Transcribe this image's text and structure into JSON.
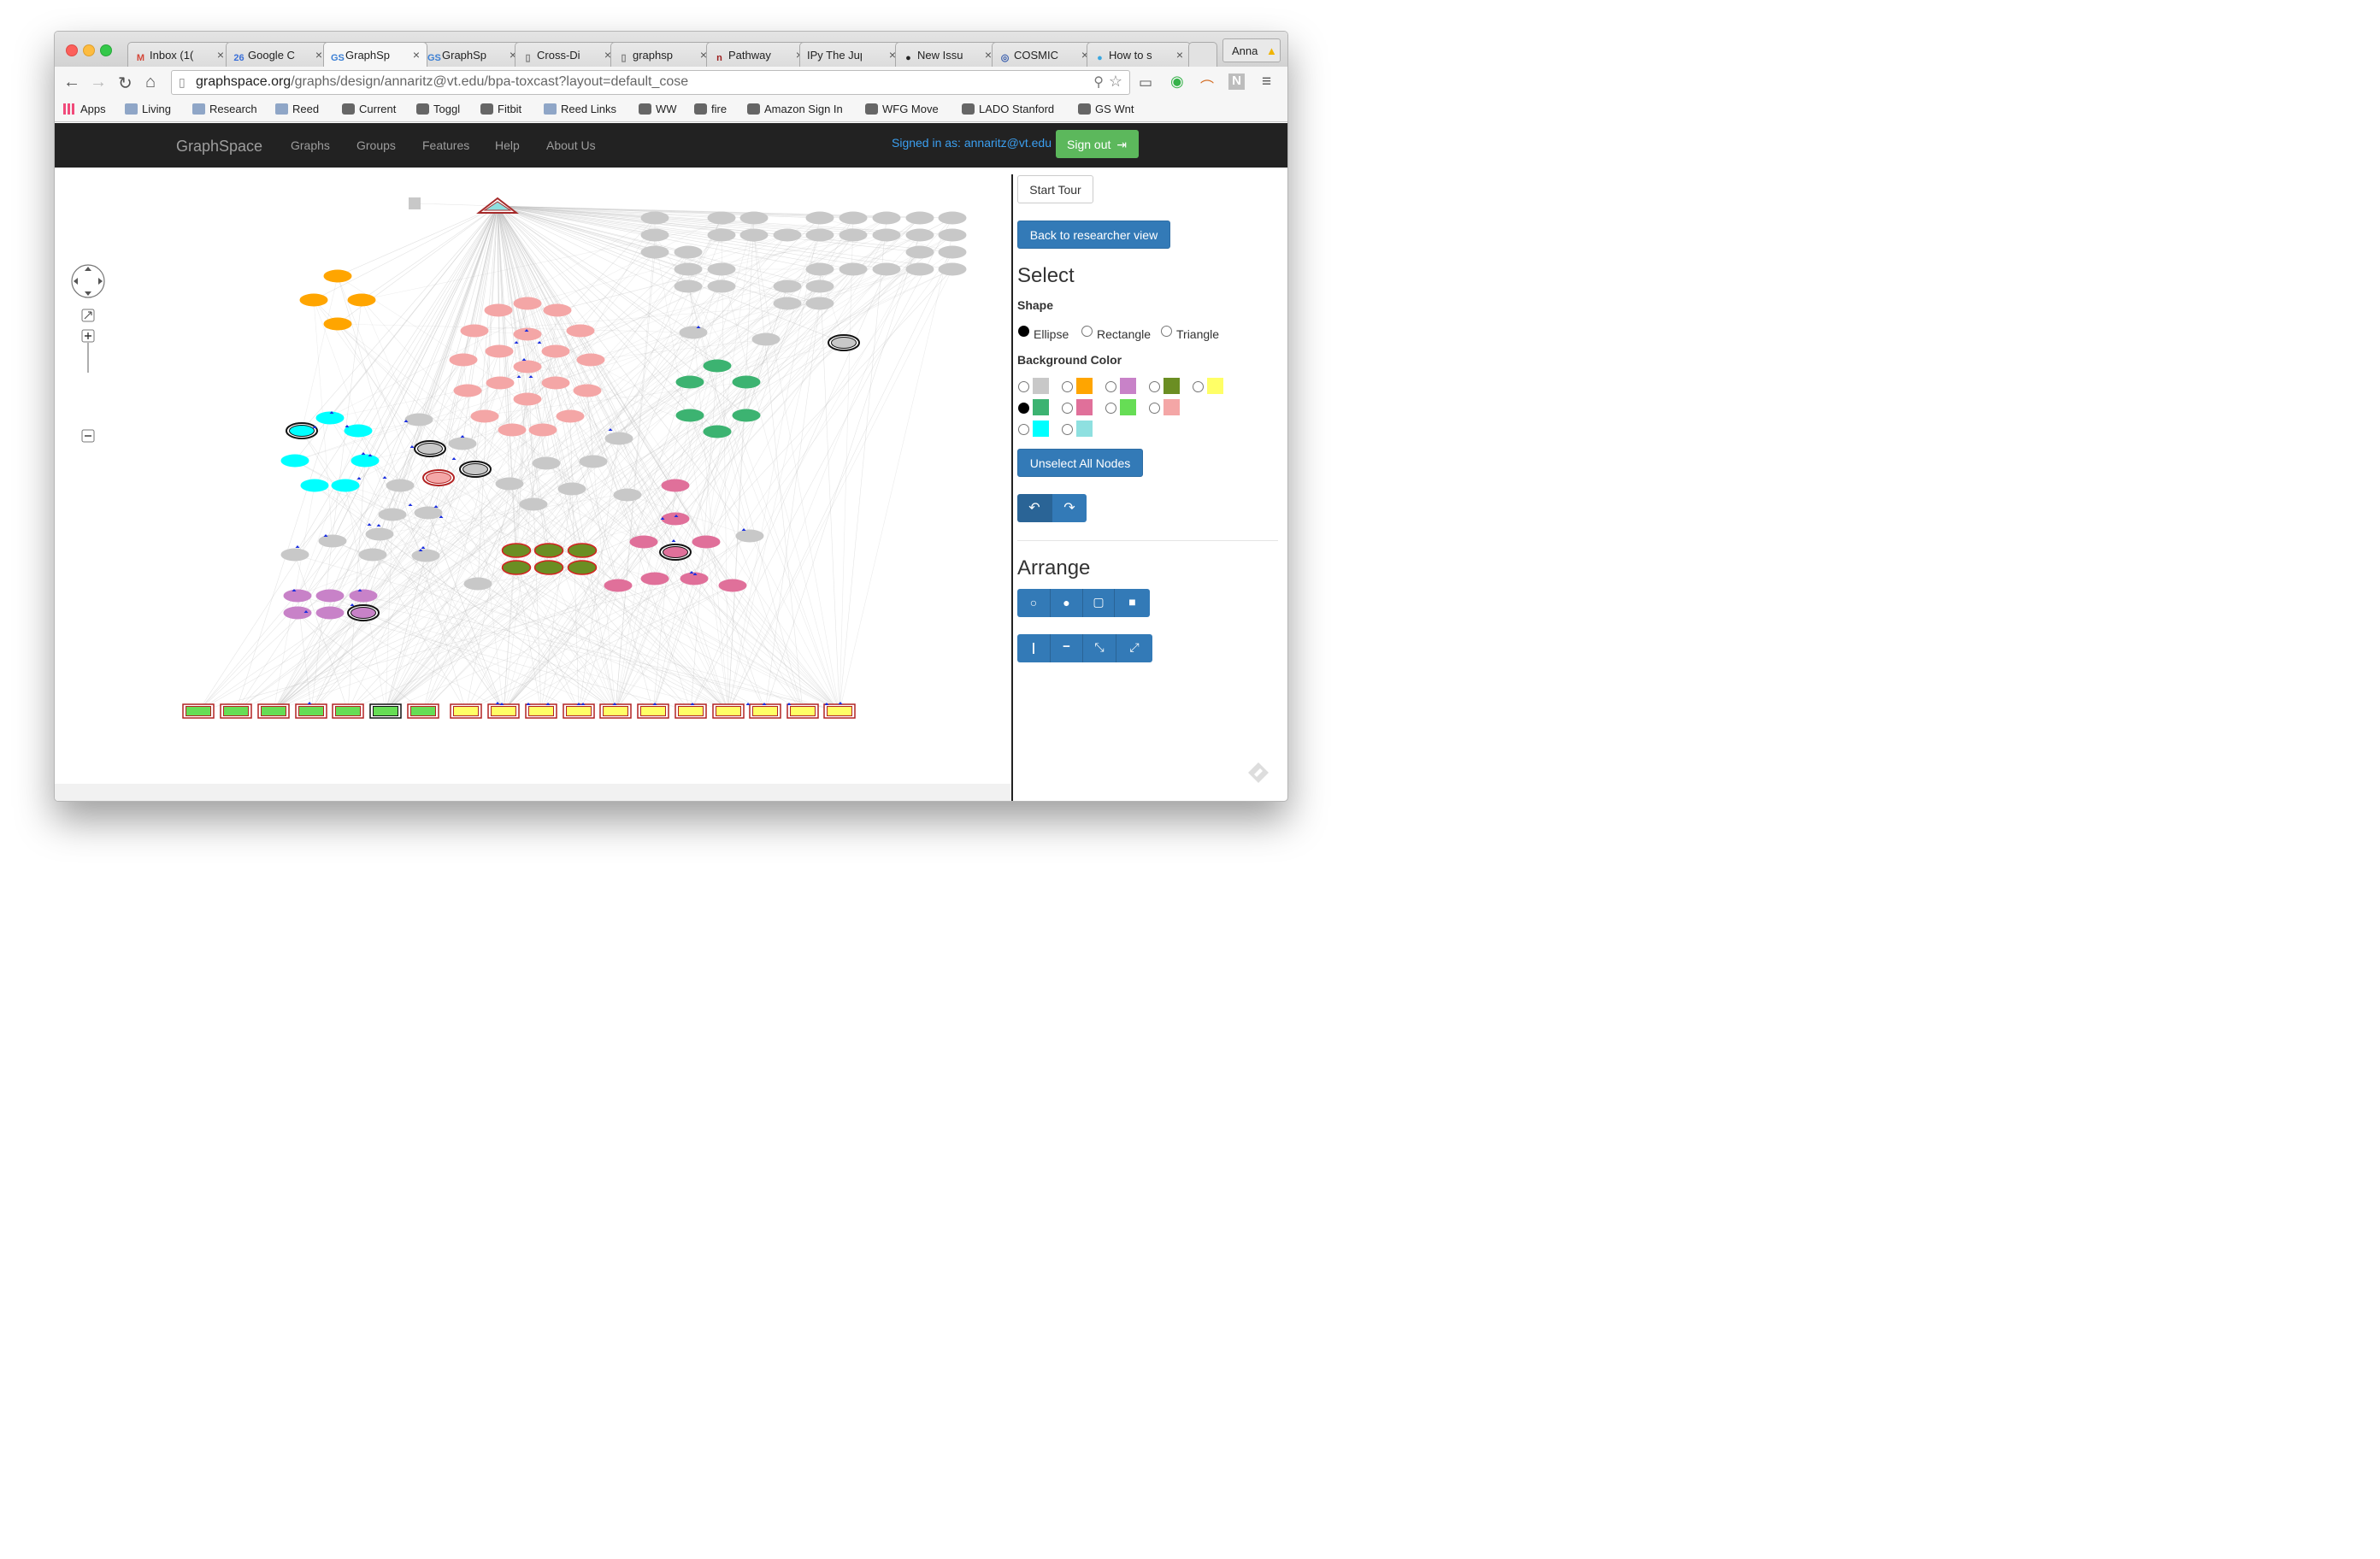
{
  "browser": {
    "tabs": [
      {
        "title": "Inbox (1(",
        "icon": "gmail-icon",
        "icon_glyph": "M",
        "icon_color": "#d44638"
      },
      {
        "title": "Google C",
        "icon": "calendar-icon",
        "icon_glyph": "26",
        "icon_color": "#3a6fd8"
      },
      {
        "title": "GraphSp",
        "icon": "graphspace-icon",
        "icon_glyph": "GS",
        "icon_color": "#3b7fd4",
        "active": true
      },
      {
        "title": "GraphSp",
        "icon": "graphspace-icon",
        "icon_glyph": "GS",
        "icon_color": "#3b7fd4"
      },
      {
        "title": "Cross-Di",
        "icon": "page-icon",
        "icon_glyph": "▯",
        "icon_color": "#777"
      },
      {
        "title": "graphsp",
        "icon": "page-icon",
        "icon_glyph": "▯",
        "icon_color": "#777"
      },
      {
        "title": "Pathway",
        "icon": "pathway-icon",
        "icon_glyph": "n",
        "icon_color": "#9b1b1b"
      },
      {
        "title": "IPy The Jupy",
        "icon": "",
        "icon_glyph": "",
        "icon_color": "#333"
      },
      {
        "title": "New Issu",
        "icon": "github-icon",
        "icon_glyph": "●",
        "icon_color": "#222"
      },
      {
        "title": "COSMIC",
        "icon": "cosmic-icon",
        "icon_glyph": "◎",
        "icon_color": "#3a5fae"
      },
      {
        "title": "How to s",
        "icon": "help-icon",
        "icon_glyph": "●",
        "icon_color": "#39a7e0"
      }
    ],
    "profile_name": "Anna",
    "url_host": "graphspace.org",
    "url_path": "/graphs/design/annaritz@vt.edu/bpa-toxcast?layout=default_cose",
    "bookmarks": [
      {
        "label": "Apps",
        "icon": "apps-icon"
      },
      {
        "label": "Living",
        "icon": "folder-icon"
      },
      {
        "label": "Research",
        "icon": "folder-icon"
      },
      {
        "label": "Reed",
        "icon": "folder-icon"
      },
      {
        "label": "Current",
        "icon": "current-icon"
      },
      {
        "label": "Toggl",
        "icon": "toggl-icon"
      },
      {
        "label": "Fitbit",
        "icon": "fitbit-icon"
      },
      {
        "label": "Reed Links",
        "icon": "folder-icon"
      },
      {
        "label": "WW",
        "icon": "ww-icon"
      },
      {
        "label": "fire",
        "icon": "fire-icon"
      },
      {
        "label": "Amazon Sign In",
        "icon": "amazon-icon"
      },
      {
        "label": "WFG Move",
        "icon": "wfg-icon"
      },
      {
        "label": "LADO Stanford",
        "icon": "lado-icon"
      },
      {
        "label": "GS Wnt",
        "icon": "graphspace-icon"
      }
    ]
  },
  "nav": {
    "brand": "GraphSpace",
    "links": [
      "Graphs",
      "Groups",
      "Features",
      "Help",
      "About Us"
    ],
    "signed_in": "Signed in as: annaritz@vt.edu",
    "sign_out": "Sign out"
  },
  "panel": {
    "start_tour": "Start Tour",
    "back_button": "Back to researcher view",
    "select_heading": "Select",
    "shape_label": "Shape",
    "shapes": [
      {
        "label": "Ellipse",
        "checked": true
      },
      {
        "label": "Rectangle",
        "checked": false
      },
      {
        "label": "Triangle",
        "checked": false
      }
    ],
    "bg_color_label": "Background Color",
    "colors": [
      {
        "hex": "#c8c8c8",
        "checked": false
      },
      {
        "hex": "#ffa500",
        "checked": false
      },
      {
        "hex": "#c882c8",
        "checked": false
      },
      {
        "hex": "#6b8e23",
        "checked": false
      },
      {
        "hex": "#ffff66",
        "checked": false
      },
      {
        "hex": "#3cb371",
        "checked": true
      },
      {
        "hex": "#e0709a",
        "checked": false
      },
      {
        "hex": "#66dd55",
        "checked": false
      },
      {
        "hex": "#f4a6a6",
        "checked": false
      },
      {
        "hex": "#00ffff",
        "checked": false
      },
      {
        "hex": "#8ee0e0",
        "checked": false
      }
    ],
    "unselect_button": "Unselect All Nodes",
    "undo_icon": "undo-icon",
    "redo_icon": "redo-icon",
    "arrange_heading": "Arrange",
    "arrange_buttons": [
      "circle-outline-icon",
      "circle-filled-icon",
      "square-outline-icon",
      "square-filled-icon"
    ],
    "align_buttons": [
      "vertical-line-icon",
      "horizontal-line-icon",
      "collapse-icon",
      "expand-icon"
    ]
  },
  "graph": {
    "colors": {
      "gray": "#c8c8c8",
      "orange": "#ffa500",
      "salmon": "#f4a6a6",
      "green": "#3cb371",
      "cyan": "#00ffff",
      "olive": "#6b8e23",
      "pink": "#e0709a",
      "purple": "#c882c8",
      "lime": "#66dd55",
      "yellow": "#ffff66",
      "teal": "#8ee0e0"
    }
  }
}
